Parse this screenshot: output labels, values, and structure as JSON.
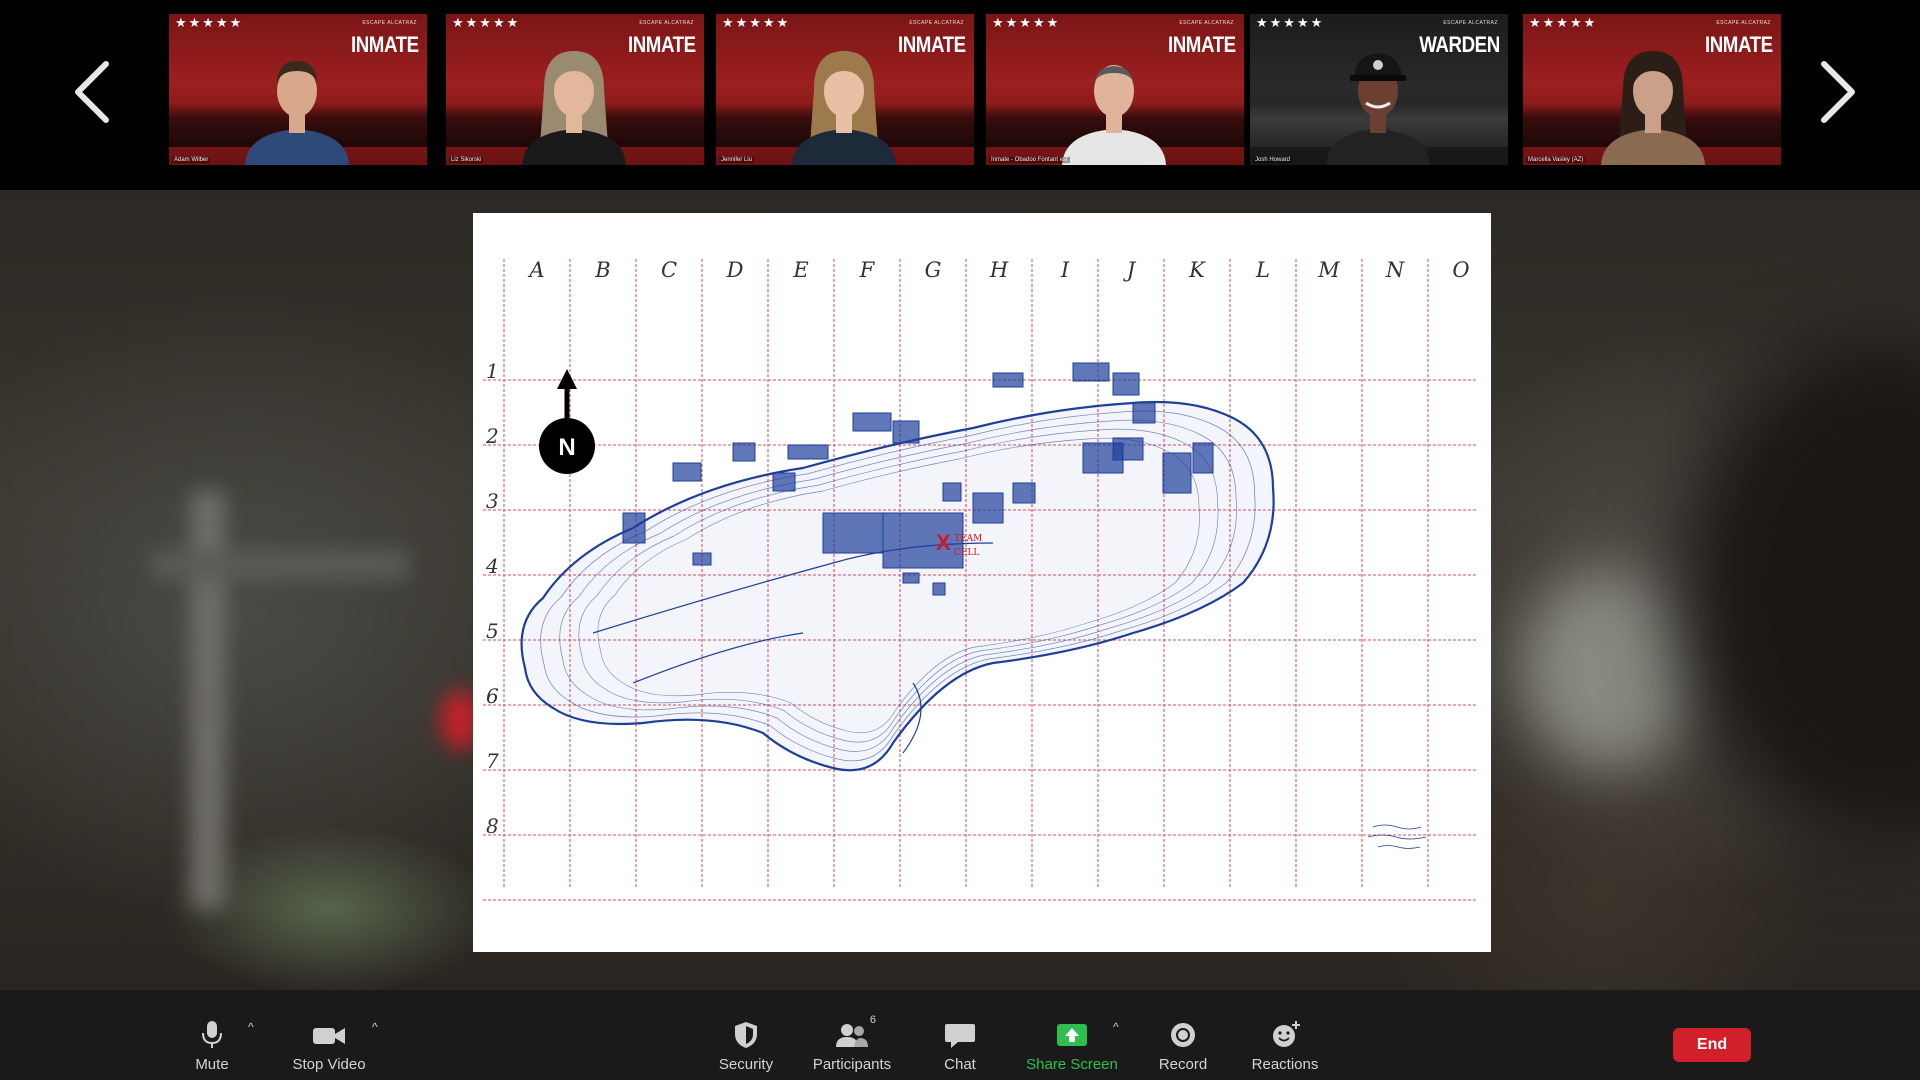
{
  "gallery": {
    "tiles": [
      {
        "stars": "★★★★★",
        "brand": "ESCAPE ALCATRAZ",
        "role": "INMATE",
        "name": "Adam Wilber",
        "skin": "#d7a88a",
        "hair": "#3a2a1c",
        "shirt": "#2e4a7a",
        "hair_style": "short"
      },
      {
        "stars": "★★★★★",
        "brand": "ESCAPE ALCATRAZ",
        "role": "INMATE",
        "name": "Liz Sikorski",
        "skin": "#e2b79b",
        "hair": "#9a8a70",
        "shirt": "#1a1a1a",
        "hair_style": "long"
      },
      {
        "stars": "★★★★★",
        "brand": "ESCAPE ALCATRAZ",
        "role": "INMATE",
        "name": "Jennifer Liu",
        "skin": "#e8c0a4",
        "hair": "#9d7a4c",
        "shirt": "#1c2a3a",
        "hair_style": "long"
      },
      {
        "stars": "★★★★★",
        "brand": "ESCAPE ALCATRAZ",
        "role": "INMATE",
        "name": "Inmate - Obadoo Fontant est",
        "skin": "#e0b49a",
        "hair": "#5a5a5a",
        "shirt": "#e6e6e6",
        "hair_style": "bald"
      },
      {
        "stars": "★★★★★",
        "brand": "ESCAPE ALCATRAZ",
        "role": "WARDEN",
        "name": "Josh Howard",
        "skin": "#6b4030",
        "hair": "#111111",
        "shirt": "#222222",
        "hair_style": "cap"
      },
      {
        "stars": "★★★★★",
        "brand": "ESCAPE ALCATRAZ",
        "role": "INMATE",
        "name": "Marcella Vasley (AZ)",
        "skin": "#caa088",
        "hair": "#2a1e16",
        "shirt": "#8a6a50",
        "hair_style": "long"
      }
    ]
  },
  "map": {
    "columns": [
      "A",
      "B",
      "C",
      "D",
      "E",
      "F",
      "G",
      "H",
      "I",
      "J",
      "K",
      "L",
      "M",
      "N",
      "O"
    ],
    "rows": [
      "1",
      "2",
      "3",
      "4",
      "5",
      "6",
      "7",
      "8"
    ],
    "compass_label": "N",
    "marker": "X",
    "marker_text_1": "TEAM",
    "marker_text_2": "CELL",
    "colors": {
      "grid": "#e0707a",
      "ink": "#1e3f9a",
      "marker": "#d01820"
    }
  },
  "toolbar": {
    "mute": "Mute",
    "stop_video": "Stop Video",
    "security": "Security",
    "participants": "Participants",
    "participants_count": "6",
    "chat": "Chat",
    "share_screen": "Share Screen",
    "record": "Record",
    "reactions": "Reactions",
    "end": "End"
  }
}
